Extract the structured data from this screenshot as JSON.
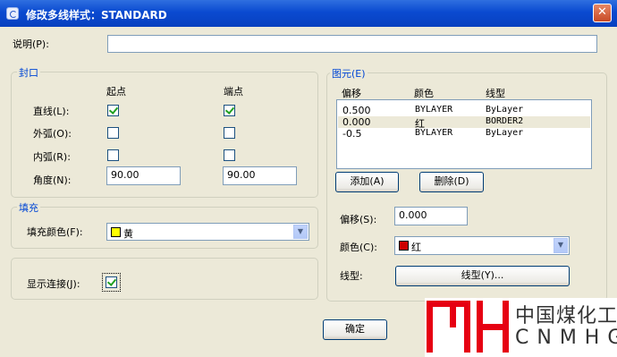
{
  "window": {
    "title": "修改多线样式：STANDARD"
  },
  "description": {
    "label": "说明(P):",
    "value": ""
  },
  "caps": {
    "title": "封口",
    "col_start": "起点",
    "col_end": "端点",
    "line_label": "直线(L):",
    "line_start": true,
    "line_end": true,
    "outer_arc_label": "外弧(O):",
    "outer_arc_start": false,
    "outer_arc_end": false,
    "inner_arc_label": "内弧(R):",
    "inner_arc_start": false,
    "inner_arc_end": false,
    "angle_label": "角度(N):",
    "angle_start": "90.00",
    "angle_end": "90.00"
  },
  "fill": {
    "title": "填充",
    "color_label": "填充颜色(F):",
    "color_value": "黄",
    "color_hex": "#ffff00"
  },
  "display_joints": {
    "label": "显示连接(J):",
    "checked": true
  },
  "elements": {
    "title": "图元(E)",
    "headers": [
      "偏移",
      "颜色",
      "线型"
    ],
    "rows": [
      {
        "offset": "0.500",
        "color": "BYLAYER",
        "linetype": "ByLayer"
      },
      {
        "offset": "0.000",
        "color": "红",
        "linetype": "BORDER2"
      },
      {
        "offset": "-0.5",
        "color": "BYLAYER",
        "linetype": "ByLayer"
      }
    ],
    "selected_row": 1,
    "add_button": "添加(A)",
    "delete_button": "删除(D)",
    "offset_label": "偏移(S):",
    "offset_value": "0.000",
    "color_label": "颜色(C):",
    "color_value": "红",
    "color_hex": "#cc0000",
    "linetype_label": "线型:",
    "linetype_button": "线型(Y)..."
  },
  "footer": {
    "ok_button": "确定"
  },
  "watermark": {
    "cn": "中国煤化工",
    "en": "CNMHG",
    "brand_color": "#e60012"
  }
}
